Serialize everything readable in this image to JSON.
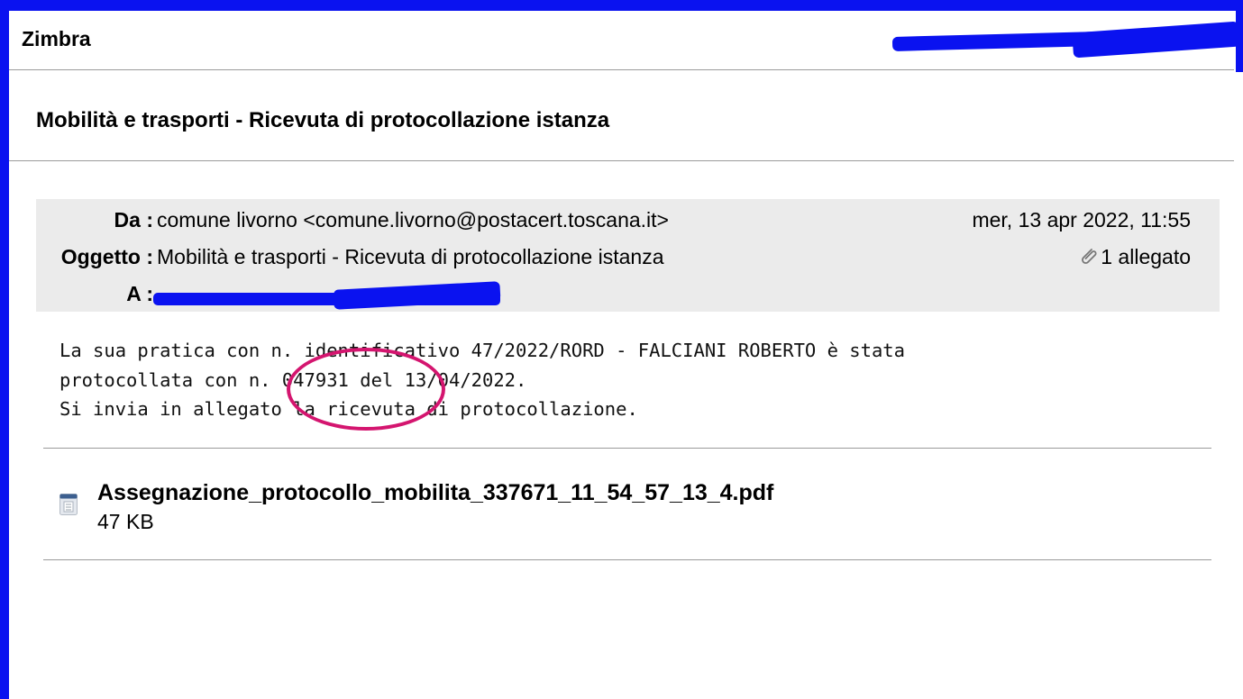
{
  "app": {
    "title": "Zimbra"
  },
  "message": {
    "subject_title": "Mobilità e trasporti - Ricevuta di protocollazione istanza",
    "from_label": "Da :",
    "from_value": "comune livorno <comune.livorno@postacert.toscana.it>",
    "date": "mer, 13 apr 2022, 11:55",
    "subject_label": "Oggetto :",
    "subject_value": "Mobilità e trasporti - Ricevuta di protocollazione istanza",
    "attachment_count": "1 allegato",
    "to_label": "A :",
    "body": "La sua pratica con n. identificativo 47/2022/RORD - FALCIANI ROBERTO è stata\nprotocollata con n. 047931 del 13/04/2022.\nSi invia in allegato la ricevuta di protocollazione."
  },
  "attachment": {
    "icon": "pdf-document-icon",
    "filename": "Assegnazione_protocollo_mobilita_337671_11_54_57_13_4.pdf",
    "size": "47 KB"
  },
  "colors": {
    "frame": "#0a12f0",
    "annotation_circle": "#d4156f",
    "header_bg": "#ebebeb"
  }
}
